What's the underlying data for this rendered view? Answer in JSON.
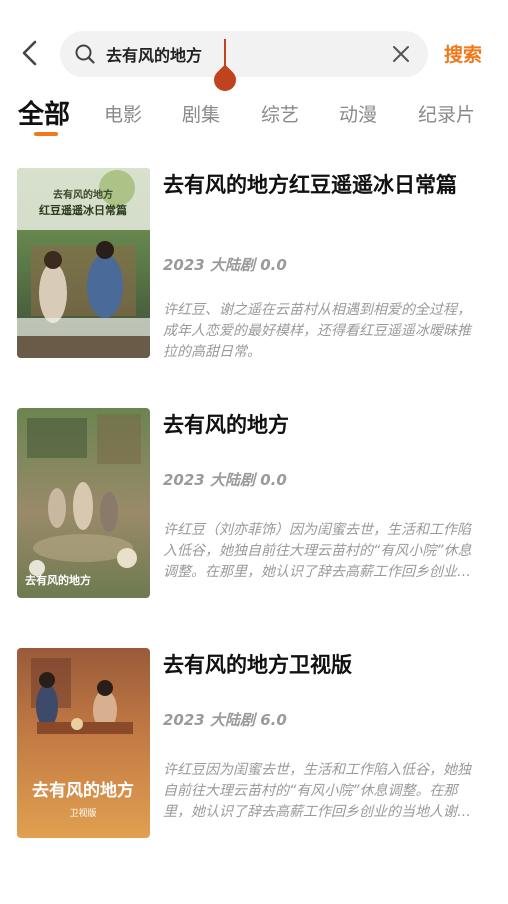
{
  "search": {
    "query": "去有风的地方",
    "button_label": "搜索"
  },
  "tabs": [
    {
      "label": "全部",
      "active": true
    },
    {
      "label": "电影",
      "active": false
    },
    {
      "label": "剧集",
      "active": false
    },
    {
      "label": "综艺",
      "active": false
    },
    {
      "label": "动漫",
      "active": false
    },
    {
      "label": "纪录片",
      "active": false
    }
  ],
  "colors": {
    "accent": "#f07a1b",
    "caret": "#c0431f",
    "muted_text": "#9a9a9a"
  },
  "results": [
    {
      "title": "去有风的地方红豆遥遥冰日常篇",
      "meta": "2023 大陆剧 0.0",
      "description": "许红豆、谢之遥在云苗村从相遇到相爱的全过程，成年人恋爱的最好模样，还得看红豆遥遥冰暧昧推拉的高甜日常。",
      "poster_text": "去有风的地方 红豆遥遥冰日常篇"
    },
    {
      "title": "去有风的地方",
      "meta": "2023 大陆剧 0.0",
      "description": "许红豆（刘亦菲饰）因为闺蜜去世，生活和工作陷入低谷，她独自前往大理云苗村的“有风小院”休息调整。在那里，她认识了辞去高薪工作回乡创业的当地人谢之遥...",
      "poster_text": "去有风的地方"
    },
    {
      "title": "去有风的地方卫视版",
      "meta": "2023 大陆剧 6.0",
      "description": "许红豆因为闺蜜去世，生活和工作陷入低谷，她独自前往大理云苗村的“有风小院”休息调整。在那里，她认识了辞去高薪工作回乡创业的当地人谢之遥，还有一群...",
      "poster_text": "去有风的地方 卫视版"
    }
  ]
}
